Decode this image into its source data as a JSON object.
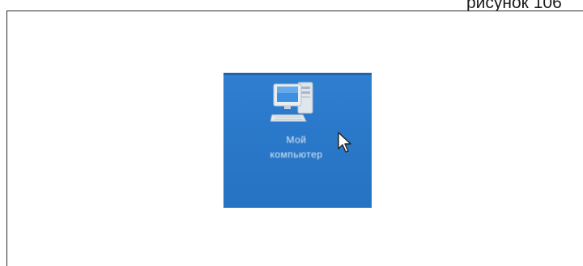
{
  "caption": {
    "text": "рисунок 106"
  },
  "desktop_icon": {
    "icon": "my-computer-icon",
    "label_line1": "Мой",
    "label_line2": "компьютер"
  },
  "colors": {
    "desktop_background": "#2a78c9",
    "label_text": "#ffffff"
  }
}
